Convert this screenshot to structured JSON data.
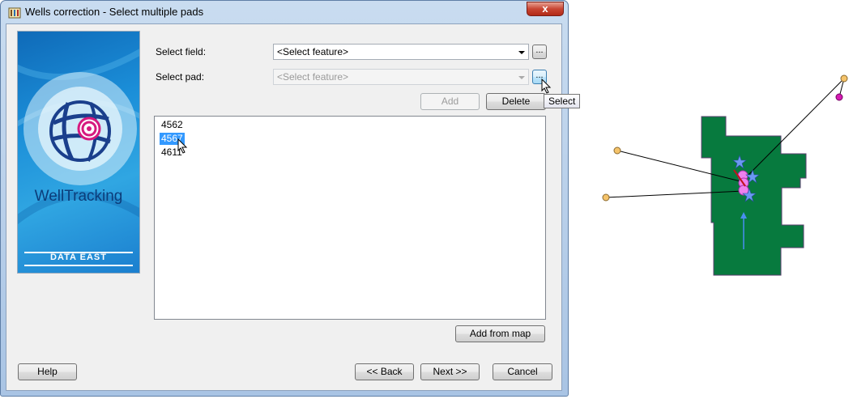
{
  "window": {
    "title": "Wells correction - Select multiple pads",
    "close_label": "x"
  },
  "banner": {
    "brand": "WellTracking",
    "company": "DATA EAST",
    "colors": {
      "primary": "#1b8ed8",
      "logo_globe": "#1a3f8c",
      "logo_target": "#d6197f"
    }
  },
  "form": {
    "field_label": "Select field:",
    "field_value": "<Select feature>",
    "pad_label": "Select pad:",
    "pad_value": "<Select feature>",
    "browse_label": "...",
    "add_label": "Add",
    "delete_label": "Delete",
    "tooltip": "Select"
  },
  "pads": [
    {
      "label": "4562",
      "selected": false
    },
    {
      "label": "4567",
      "selected": true
    },
    {
      "label": "4611",
      "selected": false
    }
  ],
  "buttons": {
    "add_from_map": "Add from map",
    "help": "Help",
    "back": "<< Back",
    "next": "Next >>",
    "cancel": "Cancel"
  },
  "map": {
    "pad_fill": "#077a3e",
    "well_line": "#000000",
    "endpoint_color": "#f5c36a",
    "marker_magenta": "#d61cb3",
    "star_color": "#5b8ef0",
    "target_color": "#ee80ee",
    "icons": [
      "star-icon",
      "circle-icon",
      "arrow-icon"
    ]
  }
}
